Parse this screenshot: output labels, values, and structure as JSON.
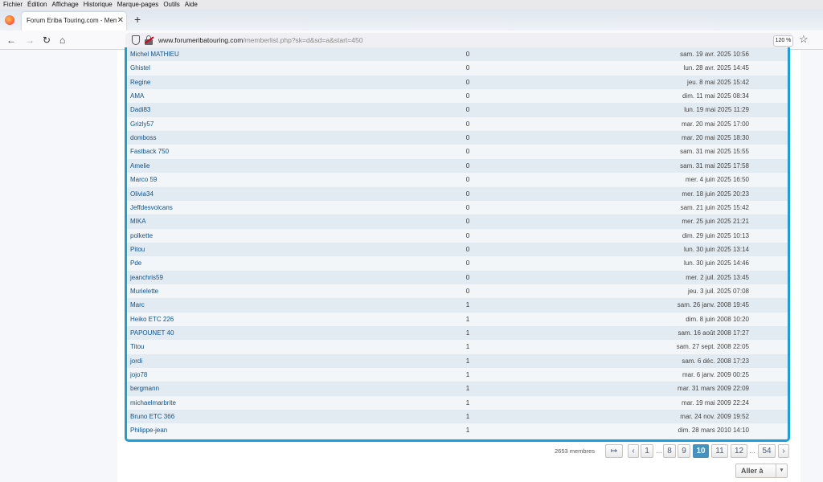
{
  "menu": [
    "Fichier",
    "Édition",
    "Affichage",
    "Historique",
    "Marque-pages",
    "Outils",
    "Aide"
  ],
  "tab": {
    "title": "Forum Eriba Touring.com - Membr",
    "close": "✕",
    "new_tab": "+"
  },
  "nav": {
    "back": "←",
    "forward": "→",
    "reload": "↻",
    "home": "⌂"
  },
  "url": {
    "host": "www.forumeribatouring.com",
    "path": "/memberlist.php?sk=d&sd=a&start=450"
  },
  "zoom": "120 %",
  "bookmark_star": "☆",
  "members": [
    {
      "name": "Michel MATHIEU",
      "posts": "0",
      "date": "sam. 19 avr. 2025 10:56"
    },
    {
      "name": "Ghistel",
      "posts": "0",
      "date": "lun. 28 avr. 2025 14:45"
    },
    {
      "name": "Regine",
      "posts": "0",
      "date": "jeu. 8 mai 2025 15:42"
    },
    {
      "name": "AMA",
      "posts": "0",
      "date": "dim. 11 mai 2025 08:34"
    },
    {
      "name": "Dadi83",
      "posts": "0",
      "date": "lun. 19 mai 2025 11:29"
    },
    {
      "name": "Grizly57",
      "posts": "0",
      "date": "mar. 20 mai 2025 17:00"
    },
    {
      "name": "domboss",
      "posts": "0",
      "date": "mar. 20 mai 2025 18:30"
    },
    {
      "name": "Fastback 750",
      "posts": "0",
      "date": "sam. 31 mai 2025 15:55"
    },
    {
      "name": "Amelie",
      "posts": "0",
      "date": "sam. 31 mai 2025 17:58"
    },
    {
      "name": "Marco 59",
      "posts": "0",
      "date": "mer. 4 juin 2025 16:50"
    },
    {
      "name": "Olivia34",
      "posts": "0",
      "date": "mer. 18 juin 2025 20:23"
    },
    {
      "name": "Jeffdesvolcans",
      "posts": "0",
      "date": "sam. 21 juin 2025 15:42"
    },
    {
      "name": "MIKA",
      "posts": "0",
      "date": "mer. 25 juin 2025 21:21"
    },
    {
      "name": "polkette",
      "posts": "0",
      "date": "dim. 29 juin 2025 10:13"
    },
    {
      "name": "Pitou",
      "posts": "0",
      "date": "lun. 30 juin 2025 13:14"
    },
    {
      "name": "Pde",
      "posts": "0",
      "date": "lun. 30 juin 2025 14:46"
    },
    {
      "name": "jeanchris59",
      "posts": "0",
      "date": "mer. 2 juil. 2025 13:45"
    },
    {
      "name": "Murielette",
      "posts": "0",
      "date": "jeu. 3 juil. 2025 07:08"
    },
    {
      "name": "Marc",
      "posts": "1",
      "date": "sam. 26 janv. 2008 19:45"
    },
    {
      "name": "Heiko ETC 226",
      "posts": "1",
      "date": "dim. 8 juin 2008 10:20"
    },
    {
      "name": "PAPOUNET 40",
      "posts": "1",
      "date": "sam. 16 août 2008 17:27"
    },
    {
      "name": "Titou",
      "posts": "1",
      "date": "sam. 27 sept. 2008 22:05"
    },
    {
      "name": "jordi",
      "posts": "1",
      "date": "sam. 6 déc. 2008 17:23"
    },
    {
      "name": "jojo78",
      "posts": "1",
      "date": "mar. 6 janv. 2009 00:25"
    },
    {
      "name": "bergmann",
      "posts": "1",
      "date": "mar. 31 mars 2009 22:09"
    },
    {
      "name": "michaelmarbrite",
      "posts": "1",
      "date": "mar. 19 mai 2009 22:24"
    },
    {
      "name": "Bruno ETC 366",
      "posts": "1",
      "date": "mar. 24 nov. 2009 19:52"
    },
    {
      "name": "Philippe-jean",
      "posts": "1",
      "date": "dim. 28 mars 2010 14:10"
    }
  ],
  "pagination": {
    "member_count": "2653 membres",
    "jump_icon": "↦",
    "prev": "‹",
    "next": "›",
    "pages": [
      "1",
      "8",
      "9",
      "10",
      "11",
      "12",
      "54"
    ],
    "current": "10",
    "ellipsis": "…"
  },
  "jump_to": {
    "label": "Aller à",
    "caret": "▾"
  },
  "colors": {
    "accent": "#1a9fd9",
    "link": "#105289",
    "active_page": "#4692bf"
  }
}
